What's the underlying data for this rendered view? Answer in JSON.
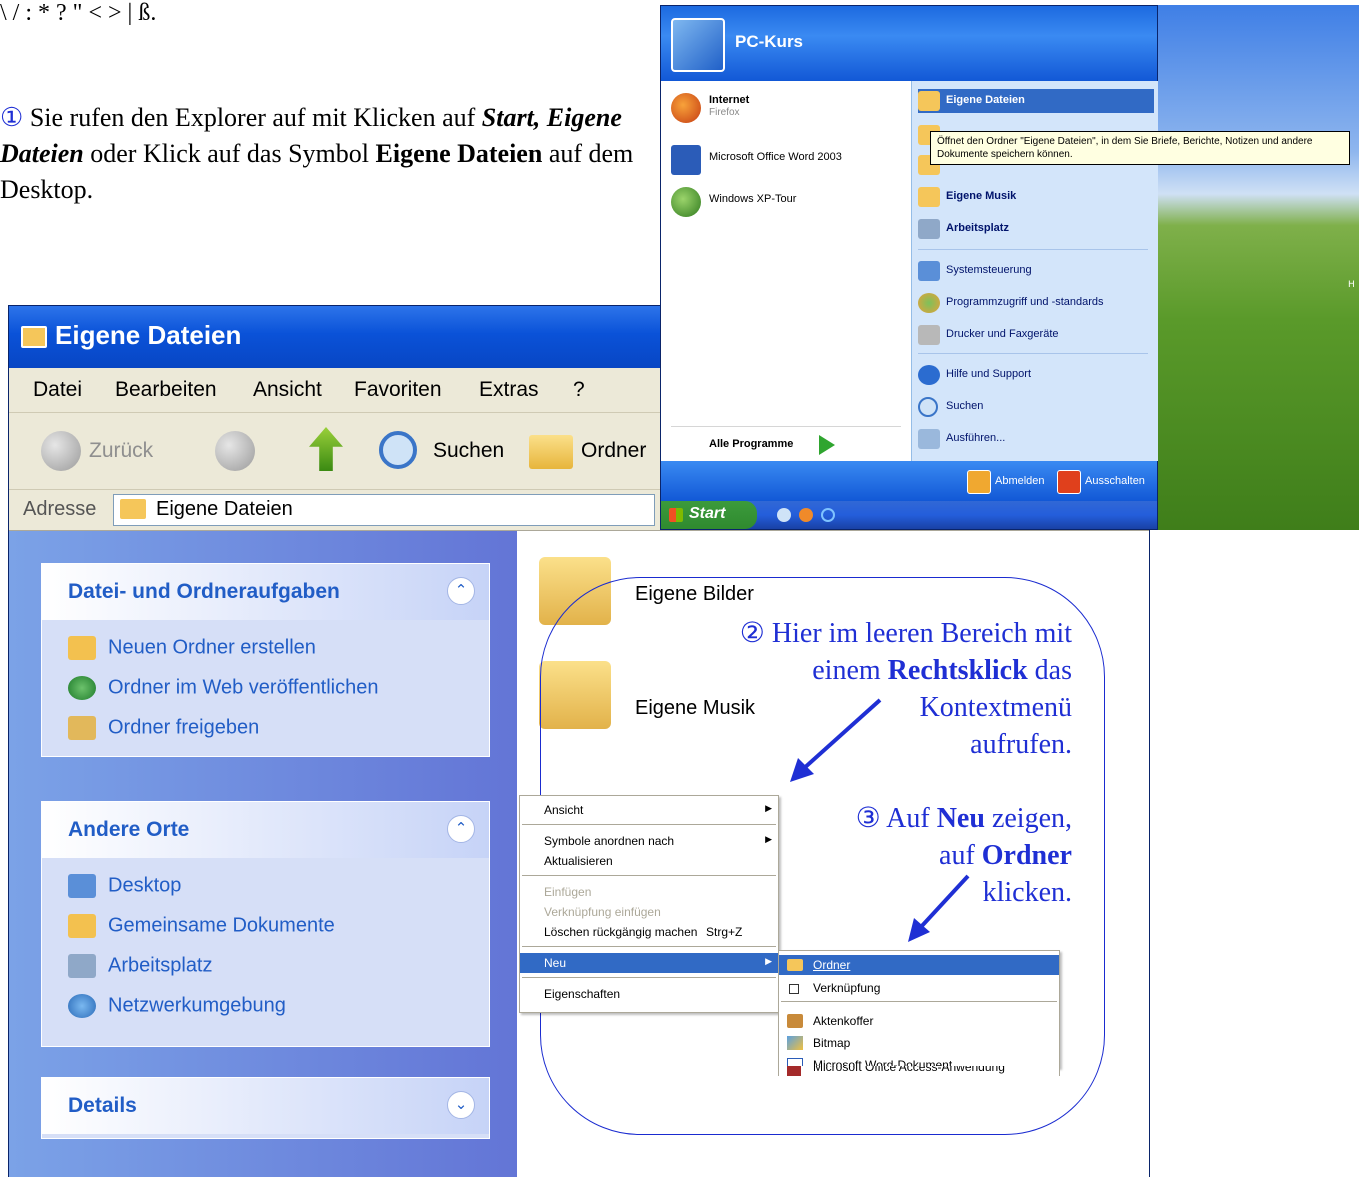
{
  "top_text": {
    "chars": "\\ / : * ? \" < > | ß."
  },
  "step1": {
    "marker": "①",
    "text_a": " Sie rufen den Explorer auf mit Klicken auf ",
    "strong_a": "Start, Eigene Dateien",
    "text_b": " oder Klick auf das Symbol ",
    "strong_b": "Eigene Dateien",
    "text_c": " auf dem Desktop."
  },
  "explorer": {
    "title": "Eigene Dateien",
    "menu": [
      "Datei",
      "Bearbeiten",
      "Ansicht",
      "Favoriten",
      "Extras",
      "?"
    ],
    "toolbar": {
      "back": "Zurück",
      "search": "Suchen",
      "folders": "Ordner"
    },
    "address_label": "Adresse",
    "address_value": "Eigene Dateien",
    "tasks_panel": {
      "title": "Datei- und Ordneraufgaben",
      "items": [
        "Neuen Ordner erstellen",
        "Ordner im Web veröffentlichen",
        "Ordner freigeben"
      ]
    },
    "places_panel": {
      "title": "Andere Orte",
      "items": [
        "Desktop",
        "Gemeinsame Dokumente",
        "Arbeitsplatz",
        "Netzwerkumgebung"
      ]
    },
    "details_panel": {
      "title": "Details"
    },
    "files": [
      "Eigene Bilder",
      "Eigene Musik"
    ]
  },
  "startmenu": {
    "user": "PC-Kurs",
    "left": [
      {
        "label": "Internet",
        "sub": "Firefox",
        "icon": "firefox-icon"
      },
      {
        "label": "Microsoft Office Word 2003",
        "icon": "word-icon"
      },
      {
        "label": "Windows XP-Tour",
        "icon": "xp-tour-icon"
      }
    ],
    "all_programs": "Alle Programme",
    "right": [
      {
        "label": "Eigene Dateien",
        "bold": true,
        "highlight": true,
        "icon": "my-documents-icon"
      },
      {
        "label": "Eigene Musik",
        "bold": true,
        "icon": "my-music-icon"
      },
      {
        "label": "Arbeitsplatz",
        "bold": true,
        "icon": "my-computer-icon"
      },
      {
        "label": "Systemsteuerung",
        "icon": "control-panel-icon"
      },
      {
        "label": "Programmzugriff und -standards",
        "icon": "program-access-icon"
      },
      {
        "label": "Drucker und Faxgeräte",
        "icon": "printer-icon"
      },
      {
        "label": "Hilfe und Support",
        "icon": "help-icon"
      },
      {
        "label": "Suchen",
        "icon": "search-icon"
      },
      {
        "label": "Ausführen...",
        "icon": "run-icon"
      }
    ],
    "logoff": "Abmelden",
    "shutdown": "Ausschalten",
    "start_button": "Start",
    "tooltip": "Öffnet den Ordner \"Eigene Dateien\", in dem Sie Briefe, Berichte, Notizen und andere Dokumente speichern können."
  },
  "desktop": {
    "hint": "H"
  },
  "context_menu": {
    "items": [
      {
        "label": "Ansicht",
        "submenu": true
      },
      {
        "label": "Symbole anordnen nach",
        "submenu": true
      },
      {
        "label": "Aktualisieren"
      },
      {
        "label": "Einfügen",
        "disabled": true
      },
      {
        "label": "Verknüpfung einfügen",
        "disabled": true
      },
      {
        "label": "Löschen rückgängig machen",
        "shortcut": "Strg+Z"
      },
      {
        "label": "Neu",
        "submenu": true,
        "highlight": true
      },
      {
        "label": "Eigenschaften"
      }
    ],
    "submenu": [
      {
        "label": "Ordner",
        "highlight": true,
        "icon": "folder-icon"
      },
      {
        "label": "Verknüpfung",
        "icon": "shortcut-icon"
      },
      {
        "label": "Aktenkoffer",
        "icon": "briefcase-icon"
      },
      {
        "label": "Bitmap",
        "icon": "bitmap-icon"
      },
      {
        "label": "Microsoft Word-Dokument",
        "icon": "word-doc-icon"
      },
      {
        "label": "Microsoft Office Access-Anwendung",
        "icon": "access-icon"
      }
    ]
  },
  "notes": {
    "step2": {
      "marker": "②",
      "a": " Hier im leeren Bereich mit",
      "b": "einem ",
      "b_strong": "Rechtsklick",
      "b_tail": " das",
      "c": "Kontextmenü",
      "d": "aufrufen."
    },
    "step3": {
      "marker": "③",
      "a": " Auf ",
      "a_strong": "Neu",
      "a_tail": " zeigen,",
      "b": "auf ",
      "b_strong": "Ordner",
      "c": "klicken."
    }
  },
  "colors": {
    "xp_blue": "#0a52d8",
    "panel_bg": "#d6dff7",
    "note_blue": "#1f2fd4",
    "highlight": "#316ac5"
  }
}
